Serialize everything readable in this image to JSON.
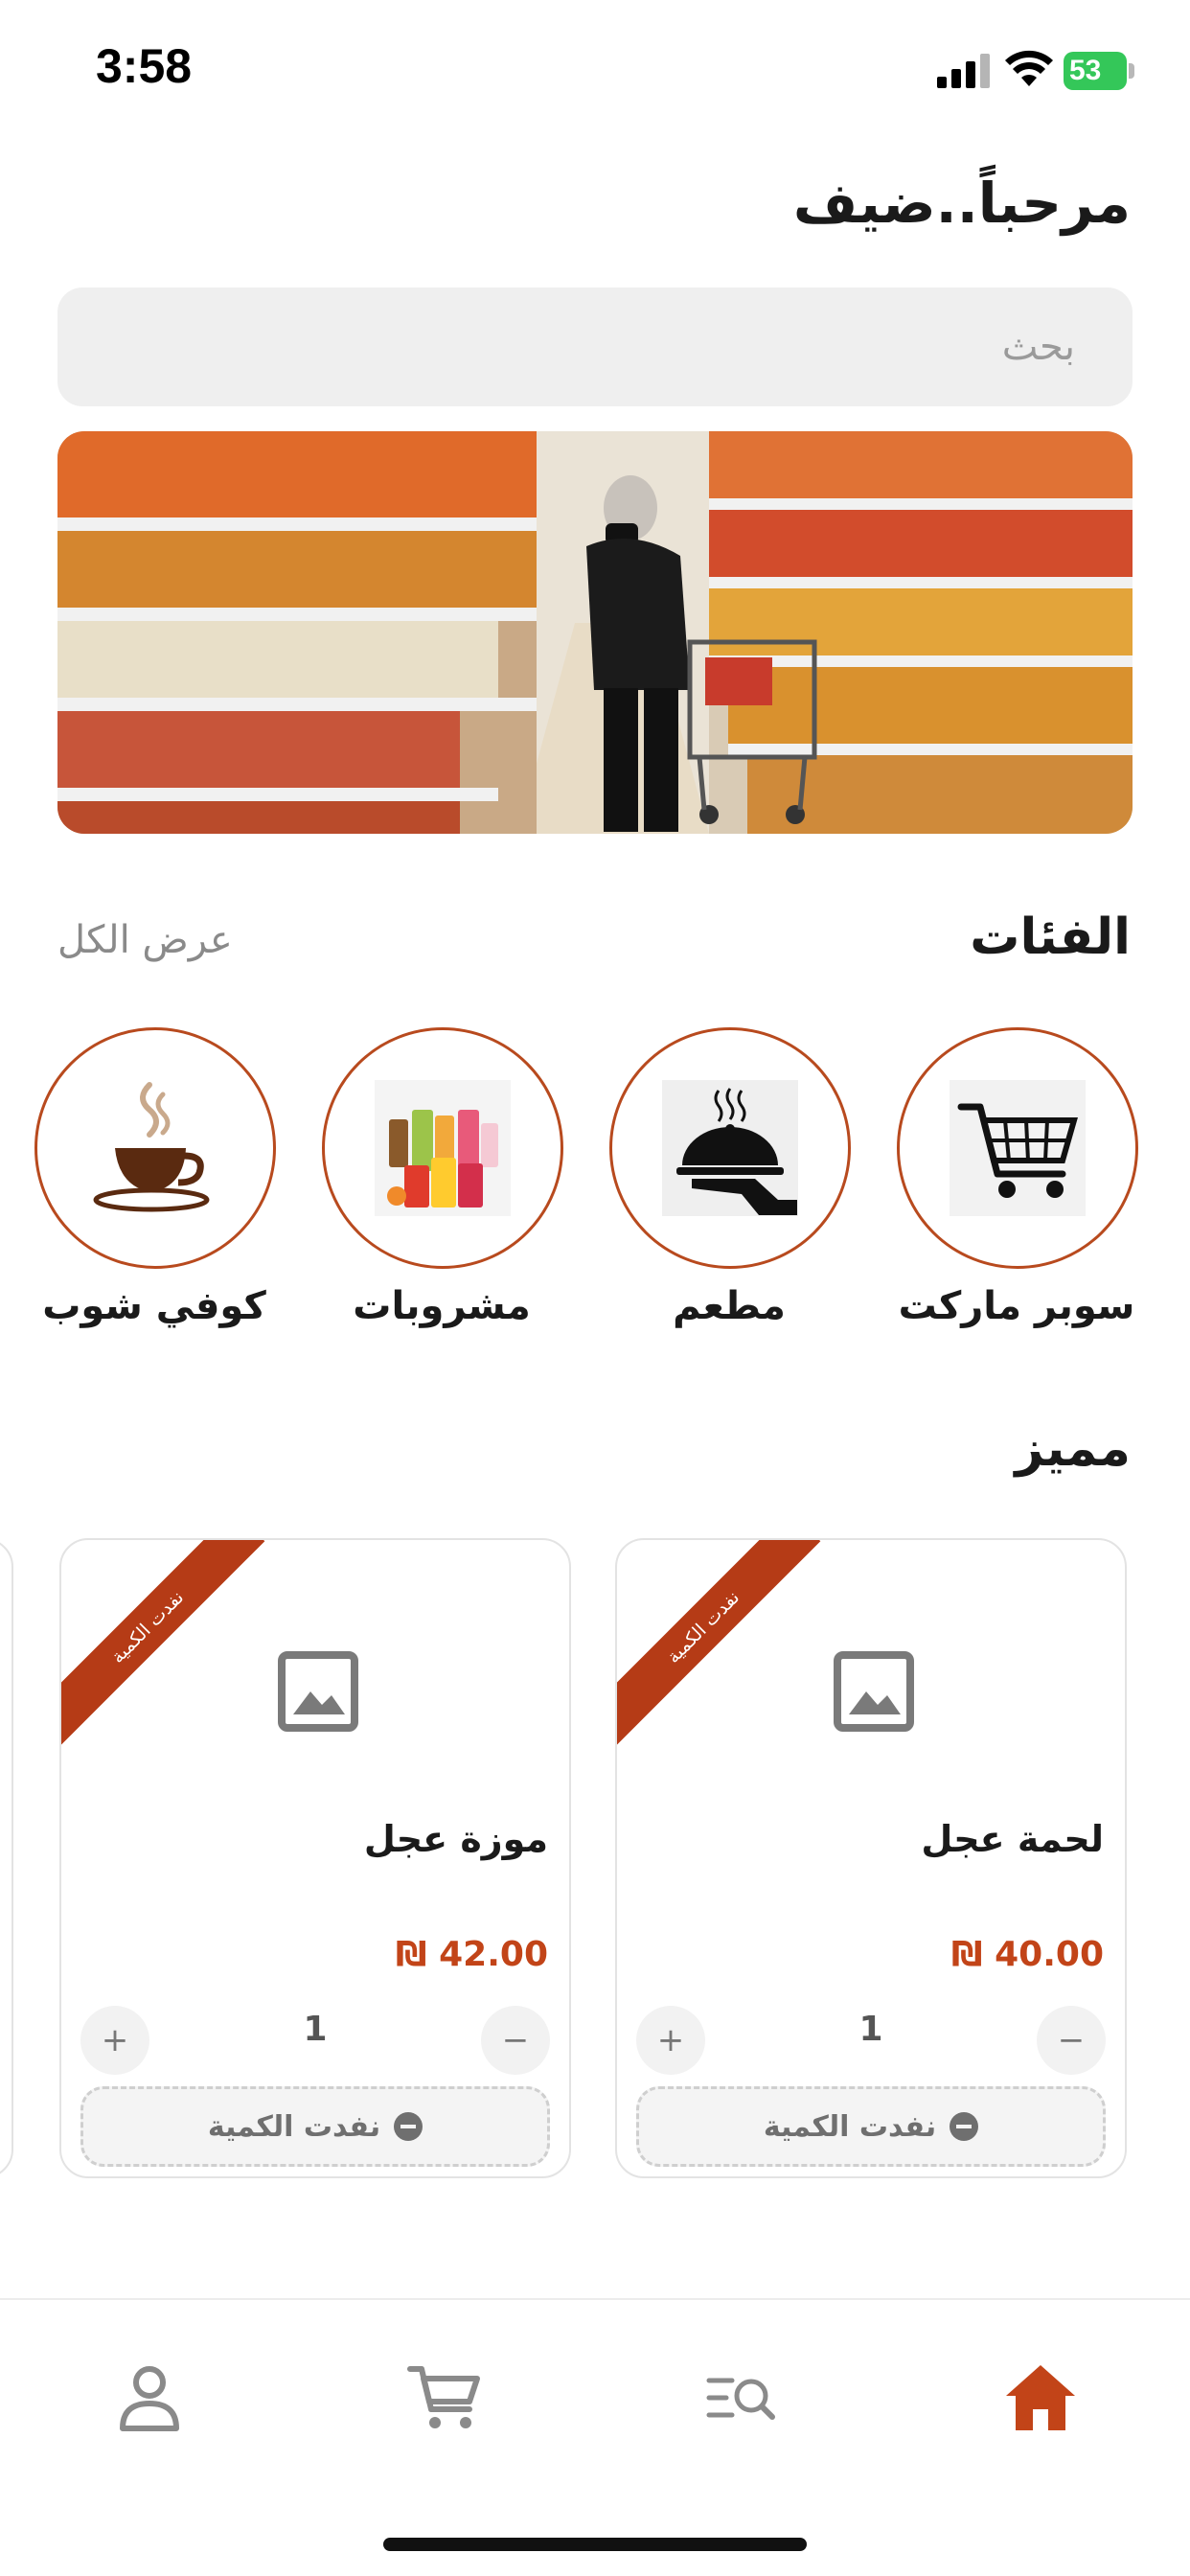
{
  "status_bar": {
    "time": "3:58",
    "battery": "53"
  },
  "greeting": "مرحباً..ضيف",
  "search": {
    "placeholder": "بحث"
  },
  "categories": {
    "title": "الفئات",
    "view_all": "عرض الكل",
    "items": [
      {
        "label": "سوبر ماركت",
        "icon": "shopping-cart-icon"
      },
      {
        "label": "مطعم",
        "icon": "serving-cloche-icon"
      },
      {
        "label": "مشروبات",
        "icon": "drinks-icon"
      },
      {
        "label": "كوفي شوب",
        "icon": "coffee-cup-icon"
      }
    ]
  },
  "featured": {
    "title": "مميز",
    "products": [
      {
        "badge": "نفدت الكمية",
        "name": "لحمة عجل",
        "price": "₪ 40.00",
        "quantity": "1",
        "status": "نفدت الكمية"
      },
      {
        "badge": "نفدت الكمية",
        "name": "موزة عجل",
        "price": "₪ 42.00",
        "quantity": "1",
        "status": "نفدت الكمية"
      }
    ]
  },
  "bottom_nav": {
    "items": [
      {
        "name": "home",
        "icon": "home-icon",
        "active": true
      },
      {
        "name": "search",
        "icon": "search-list-icon",
        "active": false
      },
      {
        "name": "cart",
        "icon": "cart-icon",
        "active": false
      },
      {
        "name": "profile",
        "icon": "profile-icon",
        "active": false
      }
    ]
  },
  "colors": {
    "accent": "#b84a1e",
    "price": "#c24418",
    "active_nav": "#c24418",
    "inactive_nav": "#8a8a8a"
  }
}
